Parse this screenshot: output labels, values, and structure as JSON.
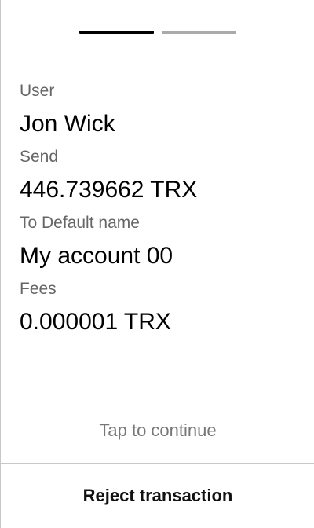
{
  "steps": {
    "total": 2,
    "current": 1,
    "active_color": "#000000",
    "inactive_color": "#aaaaaa"
  },
  "fields": [
    {
      "label": "User",
      "value": "Jon Wick"
    },
    {
      "label": "Send",
      "value": "446.739662 TRX"
    },
    {
      "label": "To Default name",
      "value": "My account 00"
    },
    {
      "label": "Fees",
      "value": "0.000001 TRX"
    }
  ],
  "hint": "Tap to continue",
  "actions": {
    "reject_label": "Reject transaction"
  }
}
